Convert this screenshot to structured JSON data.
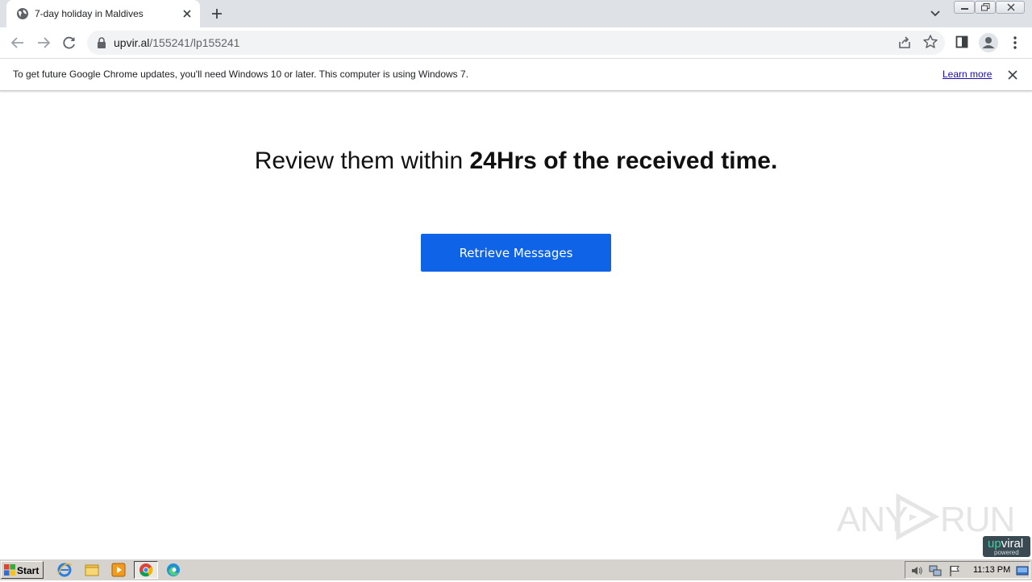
{
  "browser": {
    "tab": {
      "title": "7-day holiday in Maldives"
    },
    "address": {
      "domain": "upvir.al",
      "path": "/155241/lp155241"
    }
  },
  "infobar": {
    "message": "To get future Google Chrome updates, you'll need Windows 10 or later. This computer is using Windows 7.",
    "link": "Learn more"
  },
  "page": {
    "headline_normal": "Review them within ",
    "headline_bold": "24Hrs of the received time.",
    "button_label": "Retrieve Messages"
  },
  "watermark": {
    "left": "ANY",
    "right": "RUN",
    "badge_up": "up",
    "badge_rest": "viral",
    "badge_sub": "powered"
  },
  "taskbar": {
    "start_label": "Start",
    "clock": "11:13 PM"
  },
  "colors": {
    "button": "#0e63e6",
    "tabstrip": "#dee1e6",
    "taskbar": "#d6d3ce"
  },
  "icons": [
    "globe-icon",
    "close-icon",
    "plus-icon",
    "chevron-down-icon",
    "back-arrow-icon",
    "forward-arrow-icon",
    "reload-icon",
    "lock-icon",
    "share-icon",
    "star-icon",
    "side-panel-icon",
    "profile-icon",
    "more-vert-icon"
  ]
}
